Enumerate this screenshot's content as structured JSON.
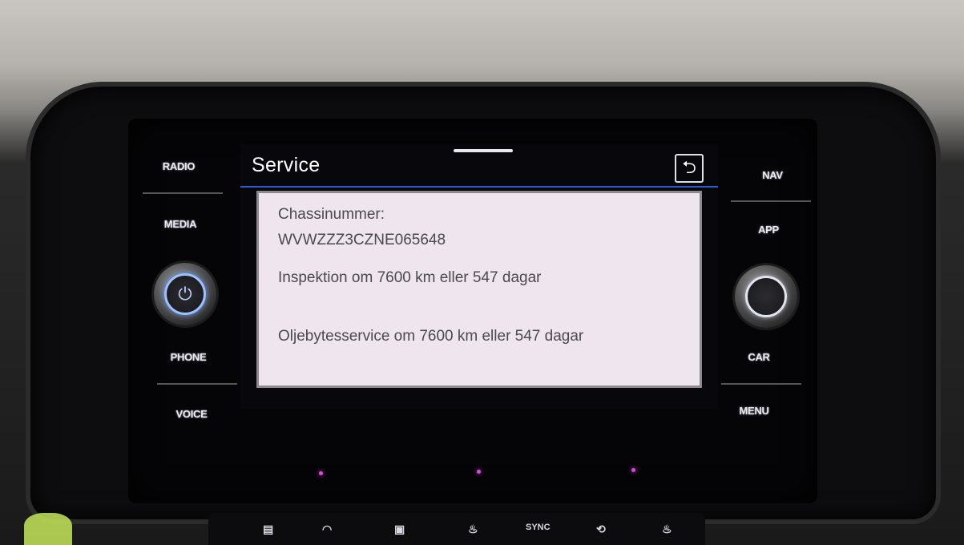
{
  "left_keys": {
    "radio": "RADIO",
    "media": "MEDIA",
    "phone": "PHONE",
    "voice": "VOICE"
  },
  "right_keys": {
    "nav": "NAV",
    "app": "APP",
    "car": "CAR",
    "menu": "MENU"
  },
  "screen": {
    "title": "Service",
    "back_icon": "back-arrow-icon",
    "chassis_label": "Chassinummer:",
    "chassis_value": "WVWZZZ3CZNE065648",
    "inspection": "Inspektion om 7600 km eller 547 dagar",
    "oil_service": "Oljebytesservice om 7600 km eller 547 dagar"
  },
  "bottom_controls": {
    "icons": [
      "rear-defrost-icon",
      "front-defrost-icon",
      "climate-menu-icon",
      "seat-heat-icon",
      "sync-label",
      "recirculation-icon",
      "seat-heat-right-icon"
    ],
    "sync_label": "SYNC"
  },
  "colors": {
    "accent_blue": "#2b5ccf",
    "card_bg": "#efe5ee",
    "indicator_purple": "#d44bd8"
  }
}
